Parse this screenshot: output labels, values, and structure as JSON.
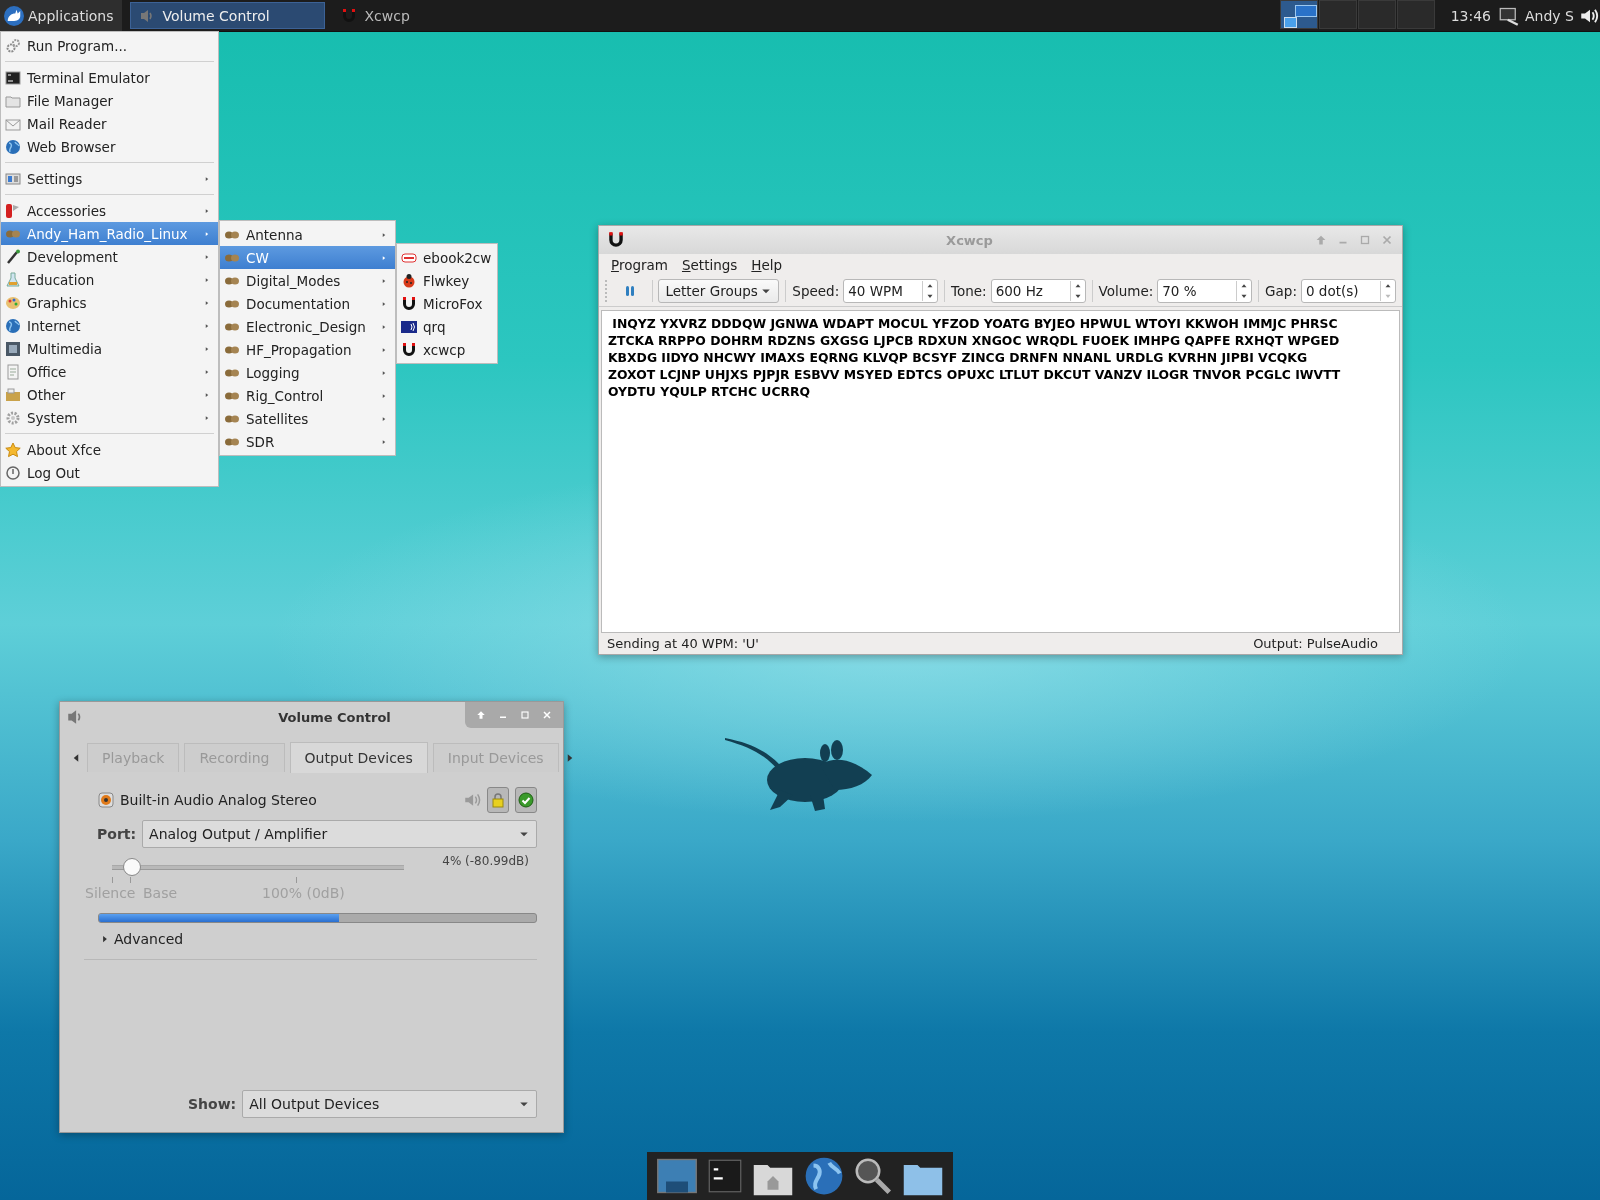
{
  "top_panel": {
    "applications_label": "Applications",
    "tasks": [
      {
        "label": "Volume Control",
        "selected": true
      },
      {
        "label": "Xcwcp",
        "selected": false
      }
    ],
    "workspaces": [
      {
        "selected": true
      },
      {
        "selected": false
      },
      {
        "selected": false
      },
      {
        "selected": false
      }
    ],
    "clock": "13:46",
    "user": "Andy S"
  },
  "applications_menu": {
    "groups": [
      [
        {
          "label": "Run Program...",
          "submenu": false,
          "selected": false
        }
      ],
      [
        {
          "label": "Terminal Emulator",
          "submenu": false,
          "selected": false
        },
        {
          "label": "File Manager",
          "submenu": false,
          "selected": false
        },
        {
          "label": "Mail Reader",
          "submenu": false,
          "selected": false
        },
        {
          "label": "Web Browser",
          "submenu": false,
          "selected": false
        }
      ],
      [
        {
          "label": "Settings",
          "submenu": true,
          "selected": false
        }
      ],
      [
        {
          "label": "Accessories",
          "submenu": true,
          "selected": false
        },
        {
          "label": "Andy_Ham_Radio_Linux",
          "submenu": true,
          "selected": true
        },
        {
          "label": "Development",
          "submenu": true,
          "selected": false
        },
        {
          "label": "Education",
          "submenu": true,
          "selected": false
        },
        {
          "label": "Graphics",
          "submenu": true,
          "selected": false
        },
        {
          "label": "Internet",
          "submenu": true,
          "selected": false
        },
        {
          "label": "Multimedia",
          "submenu": true,
          "selected": false
        },
        {
          "label": "Office",
          "submenu": true,
          "selected": false
        },
        {
          "label": "Other",
          "submenu": true,
          "selected": false
        },
        {
          "label": "System",
          "submenu": true,
          "selected": false
        }
      ],
      [
        {
          "label": "About Xfce",
          "submenu": false,
          "selected": false
        },
        {
          "label": "Log Out",
          "submenu": false,
          "selected": false
        }
      ]
    ]
  },
  "ham_radio_submenu": {
    "items": [
      {
        "label": "Antenna",
        "submenu": true,
        "selected": false
      },
      {
        "label": "CW",
        "submenu": true,
        "selected": true
      },
      {
        "label": "Digital_Modes",
        "submenu": true,
        "selected": false
      },
      {
        "label": "Documentation",
        "submenu": true,
        "selected": false
      },
      {
        "label": "Electronic_Design",
        "submenu": true,
        "selected": false
      },
      {
        "label": "HF_Propagation",
        "submenu": true,
        "selected": false
      },
      {
        "label": "Logging",
        "submenu": true,
        "selected": false
      },
      {
        "label": "Rig_Control",
        "submenu": true,
        "selected": false
      },
      {
        "label": "Satellites",
        "submenu": true,
        "selected": false
      },
      {
        "label": "SDR",
        "submenu": true,
        "selected": false
      }
    ]
  },
  "cw_submenu": {
    "items": [
      {
        "label": "ebook2cw",
        "selected": false
      },
      {
        "label": "Flwkey",
        "selected": false
      },
      {
        "label": "MicroFox",
        "selected": false
      },
      {
        "label": "qrq",
        "selected": false
      },
      {
        "label": "xcwcp",
        "selected": false
      }
    ]
  },
  "xcwcp_window": {
    "title": "Xcwcp",
    "menu": [
      "Program",
      "Settings",
      "Help"
    ],
    "mode": "Letter Groups",
    "spinners": [
      {
        "label": "Speed:",
        "value": "40 WPM",
        "at_minimum": false
      },
      {
        "label": "Tone:",
        "value": "600 Hz",
        "at_minimum": false
      },
      {
        "label": "Volume:",
        "value": "70 %",
        "at_minimum": false
      },
      {
        "label": "Gap:",
        "value": "0 dot(s)",
        "at_minimum": true
      }
    ],
    "text_lines": [
      " INQYZ YXVRZ DDDQW JGNWA WDAPT MOCUL YFZOD YOATG BYJEO HPWUL WTOYI KKWOH IMMJC PHRSC",
      "ZTCKA RRPPO DOHRM RDZNS GXGSG LJPCB RDXUN XNGOC WRQDL FUOEK IMHPG QAPFE RXHQT WPGED",
      "KBXDG IIDYO NHCWY IMAXS EQRNG KLVQP BCSYF ZINCG DRNFN NNANL URDLG KVRHN JIPBI VCQKG",
      "ZOXOT LCJNP UHJXS PJPJR ESBVV MSYED EDTCS OPUXC LTLUT DKCUT VANZV ILOGR TNVOR PCGLC IWVTT",
      "OYDTU YQULP RTCHC UCRRQ"
    ],
    "status": "Sending at 40 WPM: 'U'",
    "output": "Output: PulseAudio"
  },
  "volume_control_window": {
    "title": "Volume Control",
    "tabs": [
      {
        "label": "Playback",
        "selected": false
      },
      {
        "label": "Recording",
        "selected": false
      },
      {
        "label": "Output Devices",
        "selected": true
      },
      {
        "label": "Input Devices",
        "selected": false
      }
    ],
    "device": {
      "name": "Built-in Audio Analog Stereo",
      "muted": false,
      "locked": true,
      "default": true
    },
    "port": {
      "label": "Port:",
      "value": "Analog Output / Amplifier"
    },
    "volume": {
      "level": 0.04,
      "reading": "4% (-80.99dB)",
      "marks": [
        "Silence",
        "Base",
        "100% (0dB)"
      ]
    },
    "meter": {
      "level": 0.55
    },
    "advanced": {
      "label": "Advanced",
      "expanded": false
    },
    "show": {
      "label": "Show:",
      "value": "All Output Devices"
    }
  }
}
